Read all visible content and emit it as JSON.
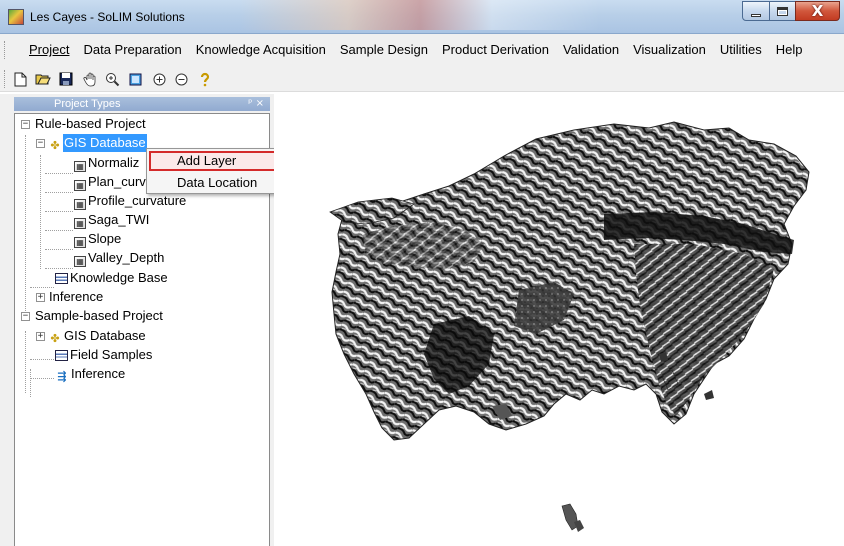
{
  "window": {
    "title": "Les Cayes - SoLIM Solutions",
    "buttons": {
      "minimize": "minimize",
      "maximize": "maximize",
      "close": "X"
    }
  },
  "menubar": {
    "items": [
      "Project",
      "Data Preparation",
      "Knowledge Acquisition",
      "Sample Design",
      "Product Derivation",
      "Validation",
      "Visualization",
      "Utilities",
      "Help"
    ]
  },
  "toolbar": {
    "icons": [
      "new-icon",
      "open-icon",
      "save-icon",
      "pan-icon",
      "zoom-in-icon",
      "full-extent-icon",
      "zoom-plus-icon",
      "zoom-minus-icon",
      "help-icon"
    ]
  },
  "dock": {
    "title": "Project Types",
    "pin": "ᵖ ×"
  },
  "tree": {
    "rule_project": "Rule-based Project",
    "gis_database": "GIS Database",
    "layers": [
      "Normaliz",
      "Plan_curv",
      "Profile_curvature",
      "Saga_TWI",
      "Slope",
      "Valley_Depth"
    ],
    "knowledge_base": "Knowledge Base",
    "inference": "Inference",
    "sample_project": "Sample-based Project",
    "sample_gis_database": "GIS Database",
    "field_samples": "Field Samples",
    "sample_inference": "Inference"
  },
  "context_menu": {
    "items": [
      "Add Layer",
      "Data Location"
    ],
    "highlighted": "Add Layer"
  },
  "colors": {
    "selection": "#3399ff",
    "highlight_border": "#d42a2a",
    "titlebar": "#b8cfe8"
  }
}
